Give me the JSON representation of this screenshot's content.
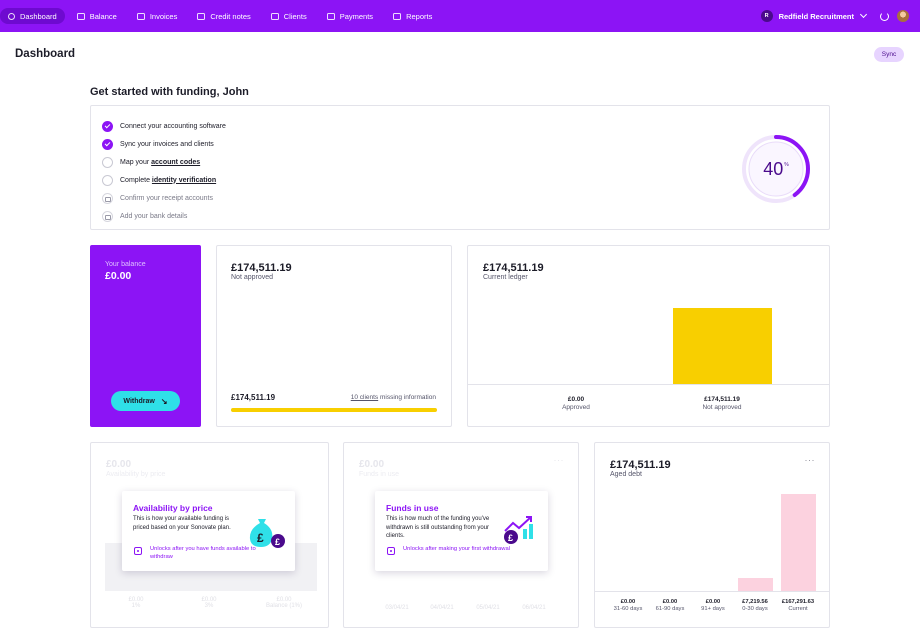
{
  "nav": {
    "items": [
      {
        "label": "Dashboard",
        "icon": "dashboard-icon",
        "active": true
      },
      {
        "label": "Balance",
        "icon": "wallet-icon",
        "active": false
      },
      {
        "label": "Invoices",
        "icon": "invoice-icon",
        "active": false
      },
      {
        "label": "Credit notes",
        "icon": "credit-note-icon",
        "active": false
      },
      {
        "label": "Clients",
        "icon": "clients-icon",
        "active": false
      },
      {
        "label": "Payments",
        "icon": "payments-icon",
        "active": false
      },
      {
        "label": "Reports",
        "icon": "reports-icon",
        "active": false
      }
    ],
    "org_initial": "R",
    "org_name": "Redfield Recruitment"
  },
  "header": {
    "title": "Dashboard",
    "sync_label": "Sync"
  },
  "funding": {
    "title": "Get started with funding, John",
    "steps": [
      {
        "prefix": "Connect your accounting software",
        "link": "",
        "state": "done"
      },
      {
        "prefix": "Sync your invoices and clients",
        "link": "",
        "state": "done"
      },
      {
        "prefix": "Map your ",
        "link": "account codes",
        "state": "todo"
      },
      {
        "prefix": "Complete ",
        "link": "identity verification",
        "state": "todo"
      },
      {
        "prefix": "Confirm your receipt accounts",
        "link": "",
        "state": "locked"
      },
      {
        "prefix": "Add your bank details",
        "link": "",
        "state": "locked"
      }
    ],
    "progress": 40,
    "progress_unit": "%"
  },
  "balance": {
    "label": "Your balance",
    "value": "£0.00",
    "withdraw_label": "Withdraw"
  },
  "not_approved": {
    "value": "£174,511.19",
    "label": "Not approved",
    "footer_value": "£174,511.19",
    "footer_link": "10 clients",
    "footer_text": " missing information"
  },
  "ledger": {
    "value": "£174,511.19",
    "label": "Current ledger",
    "columns": [
      {
        "value": "£0.00",
        "label": "Approved"
      },
      {
        "value": "£174,511.19",
        "label": "Not approved"
      }
    ]
  },
  "availability": {
    "ghost_value": "£0.00",
    "ghost_label": "Availability by price",
    "ghost_cols": [
      {
        "value": "£0.00",
        "label": "1%"
      },
      {
        "value": "£0.00",
        "label": "3%"
      },
      {
        "value": "£0.00",
        "label": "Balance (1%)"
      }
    ],
    "popup": {
      "title": "Availability by price",
      "desc": "This is how your available funding is priced based on your Sonovate plan.",
      "note": "Unlocks after you have funds available to withdraw"
    }
  },
  "funds_in_use": {
    "ghost_value": "£0.00",
    "ghost_label": "Funds in use",
    "ghost_dates": [
      "03/04/21",
      "04/04/21",
      "05/04/21",
      "06/04/21"
    ],
    "popup": {
      "title": "Funds in use",
      "desc": "This is how much of the funding you've withdrawn is still outstanding from your clients.",
      "note": "Unlocks after making your first withdrawal"
    }
  },
  "aged_debt": {
    "value": "£174,511.19",
    "label": "Aged debt",
    "columns": [
      {
        "value": "£0.00",
        "label": "31-60 days"
      },
      {
        "value": "£0.00",
        "label": "61-90 days"
      },
      {
        "value": "£0.00",
        "label": "91+ days"
      },
      {
        "value": "£7,219.56",
        "label": "0-30 days"
      },
      {
        "value": "£167,291.63",
        "label": "Current"
      }
    ]
  },
  "colors": {
    "brand": "#8c14f5",
    "accent": "#2fe0e8",
    "yellow": "#f8cf00",
    "pink": "#fcd2df"
  }
}
